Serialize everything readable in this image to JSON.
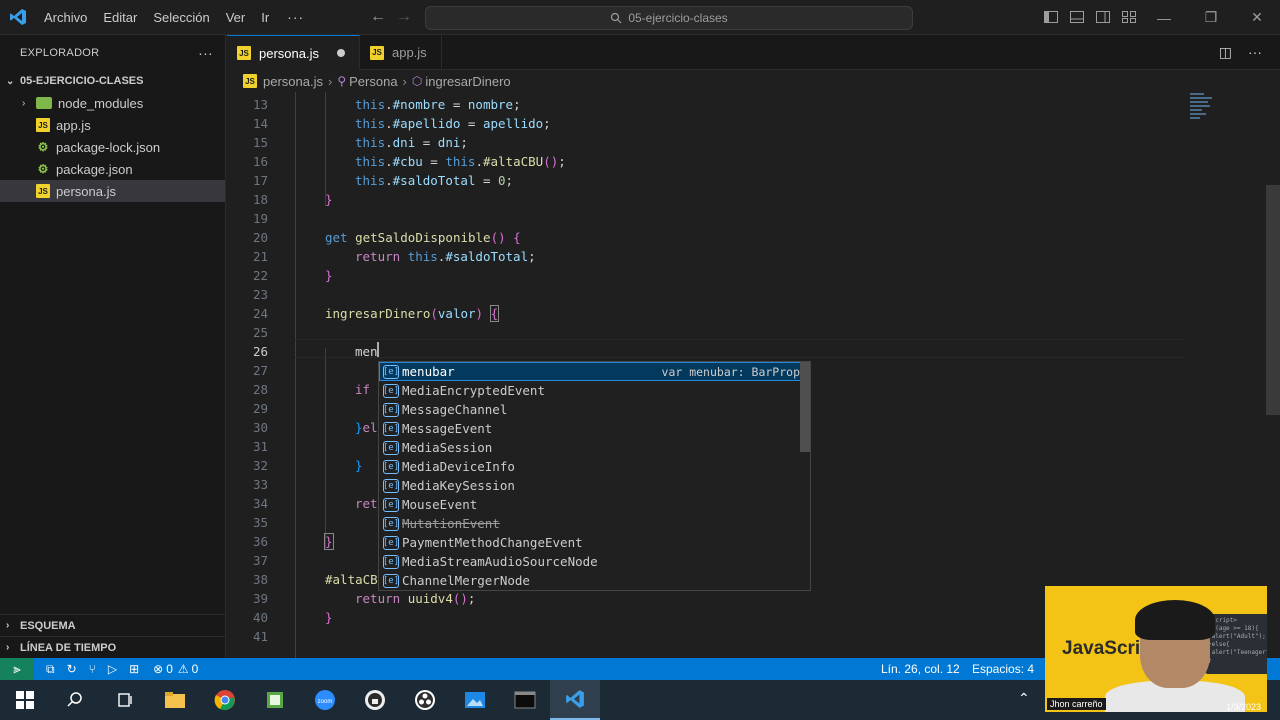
{
  "titlebar": {
    "menu": [
      "Archivo",
      "Editar",
      "Selección",
      "Ver",
      "Ir"
    ],
    "more": "···",
    "search": "05-ejercicio-clases"
  },
  "sidebar": {
    "header": "EXPLORADOR",
    "project": "05-EJERCICIO-CLASES",
    "items": [
      {
        "label": "node_modules",
        "type": "folder"
      },
      {
        "label": "app.js",
        "type": "js"
      },
      {
        "label": "package-lock.json",
        "type": "json"
      },
      {
        "label": "package.json",
        "type": "json"
      },
      {
        "label": "persona.js",
        "type": "js",
        "selected": true
      }
    ],
    "outline": "ESQUEMA",
    "timeline": "LÍNEA DE TIEMPO"
  },
  "tabs": [
    {
      "label": "persona.js",
      "active": true
    },
    {
      "label": "app.js",
      "active": false
    }
  ],
  "breadcrumb": [
    "persona.js",
    "Persona",
    "ingresarDinero"
  ],
  "suggestions": [
    {
      "label": "menubar",
      "detail": "var menubar: BarProp",
      "selected": true
    },
    {
      "label": "MediaEncryptedEvent"
    },
    {
      "label": "MessageChannel"
    },
    {
      "label": "MessageEvent"
    },
    {
      "label": "MediaSession"
    },
    {
      "label": "MediaDeviceInfo"
    },
    {
      "label": "MediaKeySession"
    },
    {
      "label": "MouseEvent"
    },
    {
      "label": "MutationEvent",
      "deprecated": true
    },
    {
      "label": "PaymentMethodChangeEvent"
    },
    {
      "label": "MediaStreamAudioSourceNode"
    },
    {
      "label": "ChannelMergerNode"
    }
  ],
  "statusbar": {
    "errors": "0",
    "warnings": "0",
    "position": "Lín. 26, col. 12",
    "spaces": "Espacios: 4"
  },
  "webcam": {
    "title": "JavaScri",
    "name": "Jhon carreño",
    "date": "1/3/2023"
  },
  "colors": {
    "accent": "#0078d4",
    "remote": "#16825d",
    "js_icon": "#f1d22c"
  }
}
